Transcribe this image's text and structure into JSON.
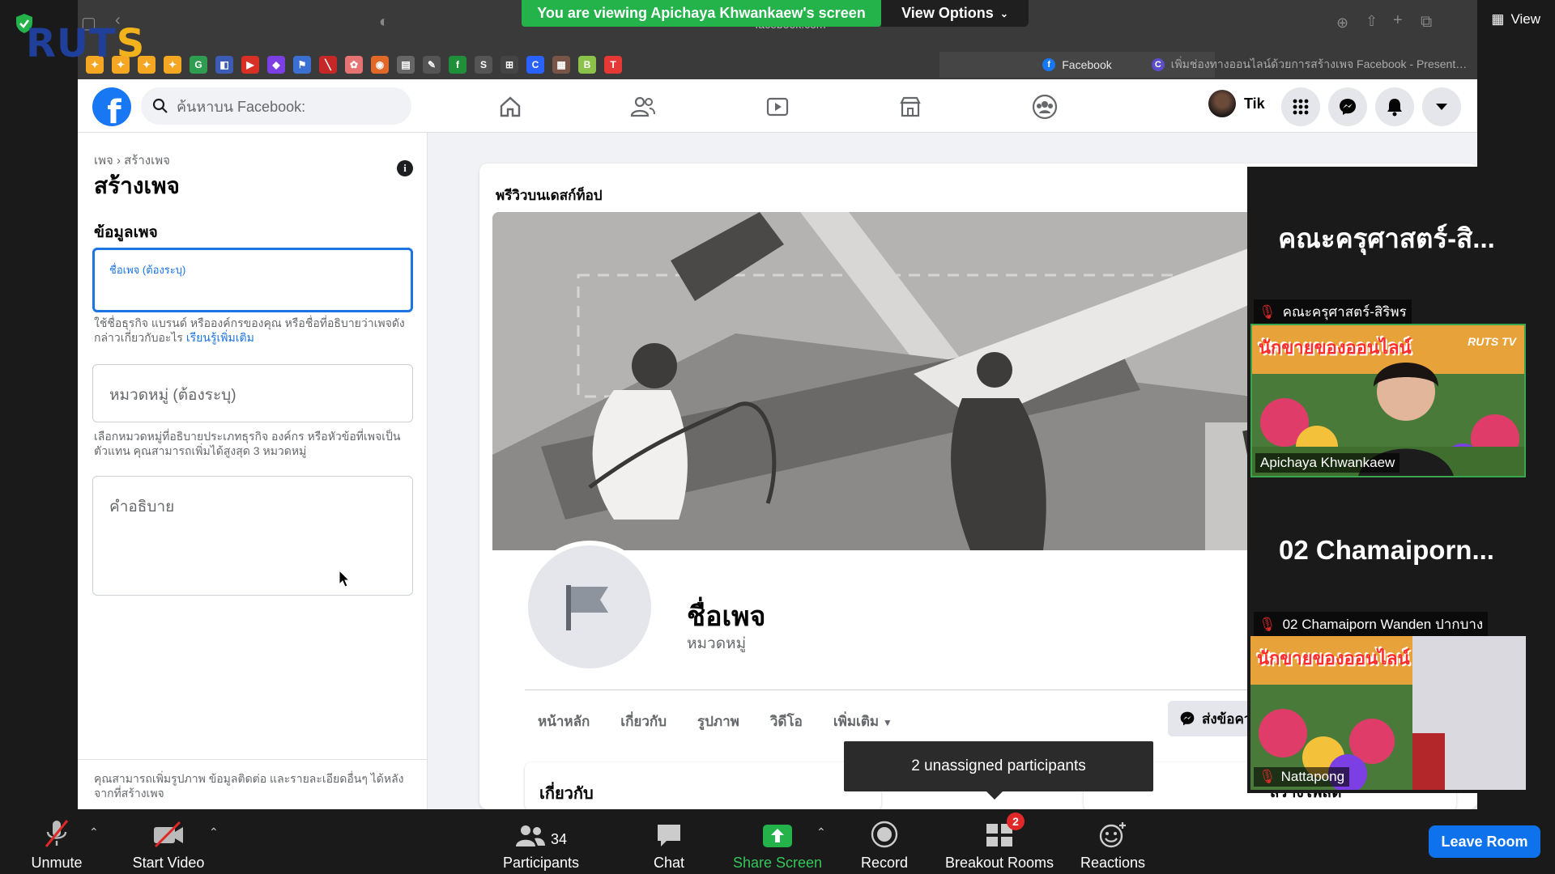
{
  "zoom": {
    "viewing_banner": "You are viewing Apichaya Khwankaew's screen",
    "view_options_label": "View Options",
    "view_label": "View",
    "tooltip": "2 unassigned participants",
    "toolbar": {
      "unmute": "Unmute",
      "start_video": "Start Video",
      "participants": "Participants",
      "participants_count": "34",
      "chat": "Chat",
      "share_screen": "Share Screen",
      "record": "Record",
      "breakout_rooms": "Breakout Rooms",
      "breakout_badge": "2",
      "reactions": "Reactions",
      "leave_room": "Leave Room"
    },
    "gallery": [
      {
        "big_name": "คณะครุศาสตร์-สิ...",
        "label": "คณะครุศาสตร์-สิริพร"
      },
      {
        "video_label": "Apichaya Khwankaew"
      },
      {
        "big_name": "02  Chamaiporn...",
        "label": "02 Chamaiporn Wanden ปากบาง"
      },
      {
        "video_label": "Nattapong"
      }
    ],
    "video_banner_text": "นักขายของออนไลน์",
    "video_logo_text": "RUTS TV"
  },
  "browser": {
    "url_fragment": "facebook.com",
    "active_tab": "Facebook",
    "inactive_tab": "เพิ่มช่องทางออนไลน์ด้วยการสร้างเพจ Facebook - Presentatio...",
    "watermark": "RUTS"
  },
  "facebook": {
    "search_placeholder": "ค้นหาบน Facebook:",
    "user_name": "Tik",
    "breadcrumb": "เพจ › สร้างเพจ",
    "create_title": "สร้างเพจ",
    "section_title": "ข้อมูลเพจ",
    "page_name_label": "ชื่อเพจ (ต้องระบุ)",
    "page_name_hint": "ใช้ชื่อธุรกิจ แบรนด์ หรือองค์กรของคุณ หรือชื่อที่อธิบายว่าเพจดังกล่าวเกี่ยวกับอะไร",
    "learn_more": "เรียนรู้เพิ่มเติม",
    "category_placeholder": "หมวดหมู่ (ต้องระบุ)",
    "category_hint": "เลือกหมวดหมู่ที่อธิบายประเภทธุรกิจ องค์กร หรือหัวข้อที่เพจเป็นตัวแทน คุณสามารถเพิ่มได้สูงสุด 3 หมวดหมู่",
    "description_placeholder": "คำอธิบาย",
    "footer_hint": "คุณสามารถเพิ่มรูปภาพ ข้อมูลติดต่อ และรายละเอียดอื่นๆ ได้หลังจากที่สร้างเพจ",
    "preview_label": "พรีวิวบนเดสก์ท็อป",
    "preview_page_name": "ชื่อเพจ",
    "preview_category": "หมวดหมู่",
    "preview_tabs": [
      "หน้าหลัก",
      "เกี่ยวกับ",
      "รูปภาพ",
      "วิดีโอ",
      "เพิ่มเติม"
    ],
    "message_button": "ส่งข้อควา",
    "about_card_title": "เกี่ยวกับ",
    "create_post": "สร้างโพสต์"
  },
  "colors": {
    "fb_blue": "#1877f2",
    "zoom_green": "#24b34b",
    "zoom_blue": "#0e72ed",
    "danger": "#e02828"
  }
}
